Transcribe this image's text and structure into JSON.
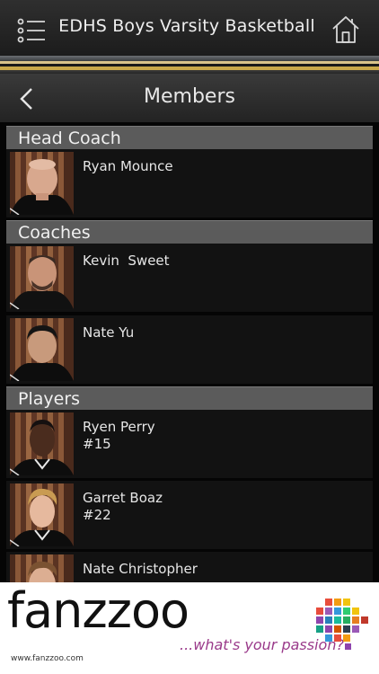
{
  "app": {
    "title": "EDHS Boys Varsity Basketball"
  },
  "nav": {
    "title": "Members"
  },
  "sections": {
    "head_coach": "Head Coach",
    "coaches": "Coaches",
    "players": "Players"
  },
  "members": {
    "head_coach": [
      {
        "name": "Ryan Mounce"
      }
    ],
    "coaches": [
      {
        "name": "Kevin  Sweet"
      },
      {
        "name": "Nate Yu"
      }
    ],
    "players": [
      {
        "name": "Ryen Perry",
        "number": "#15"
      },
      {
        "name": "Garret Boaz",
        "number": "#22"
      },
      {
        "name": "Nate Christopher"
      }
    ]
  },
  "footer": {
    "logo": "fanzzoo",
    "website": "www.fanzzoo.com",
    "tagline": "...what's your passion?"
  },
  "colors": {
    "gold_stripe": "#c9a84a",
    "tagline": "#9a3a8a"
  }
}
